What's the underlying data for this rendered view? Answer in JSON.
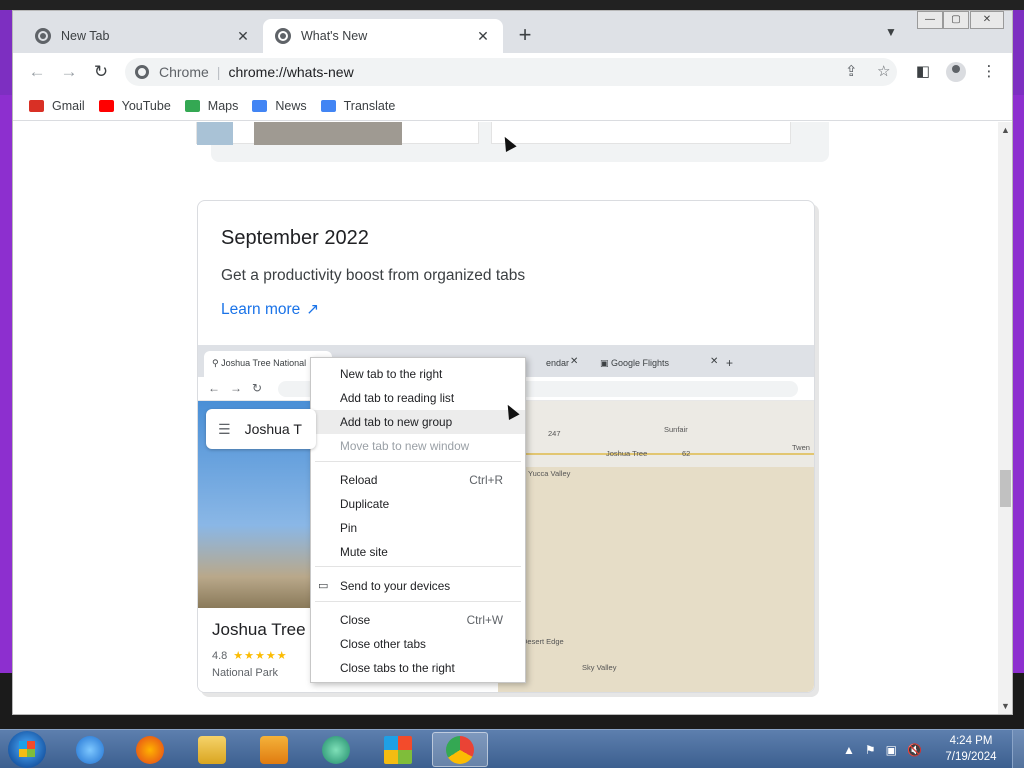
{
  "browser": {
    "tabs": [
      {
        "label": "New Tab",
        "icon": "chrome-icon"
      },
      {
        "label": "What's New",
        "icon": "chrome-icon",
        "active": true
      }
    ],
    "omnibox": {
      "site": "Chrome",
      "url": "chrome://whats-new"
    },
    "bookmarks": [
      {
        "label": "Gmail",
        "color": "#d93025"
      },
      {
        "label": "YouTube",
        "color": "#ff0000"
      },
      {
        "label": "Maps",
        "color": "#34a853"
      },
      {
        "label": "News",
        "color": "#4285f4"
      },
      {
        "label": "Translate",
        "color": "#4285f4"
      }
    ]
  },
  "card": {
    "date": "September 2022",
    "subtitle": "Get a productivity boost from organized tabs",
    "link": "Learn more"
  },
  "screenshot": {
    "tab_label": "Joshua Tree National",
    "tab_b": "endar",
    "tab_c": "Google Flights",
    "search_text": "Joshua T",
    "place_title": "Joshua Tree",
    "rating": "4.8",
    "stars": "★★★★★",
    "place_type": "National Park",
    "map_labels": [
      "Sunfair",
      "Joshua Tree",
      "Twen",
      "Yucca Valley",
      "Desert Edge",
      "Sky Valley",
      "62",
      "247"
    ]
  },
  "context_menu": {
    "items": [
      {
        "label": "New tab to the right",
        "shortcut": ""
      },
      {
        "label": "Add tab to reading list",
        "shortcut": ""
      },
      {
        "label": "Add tab to new group",
        "shortcut": "",
        "hover": true
      },
      {
        "label": "Move tab to new window",
        "shortcut": "",
        "disabled": true
      },
      {
        "label": "Reload",
        "shortcut": "Ctrl+R"
      },
      {
        "label": "Duplicate",
        "shortcut": ""
      },
      {
        "label": "Pin",
        "shortcut": ""
      },
      {
        "label": "Mute site",
        "shortcut": ""
      },
      {
        "label": "Send to your devices",
        "shortcut": ""
      },
      {
        "label": "Close",
        "shortcut": "Ctrl+W"
      },
      {
        "label": "Close other tabs",
        "shortcut": ""
      },
      {
        "label": "Close tabs to the right",
        "shortcut": ""
      }
    ]
  },
  "taskbar": {
    "clock_time": "4:24 PM",
    "clock_date": "7/19/2024",
    "apps": [
      "internet-explorer",
      "firefox",
      "file-explorer",
      "media-player",
      "app-green",
      "windows-logo",
      "chrome"
    ]
  }
}
